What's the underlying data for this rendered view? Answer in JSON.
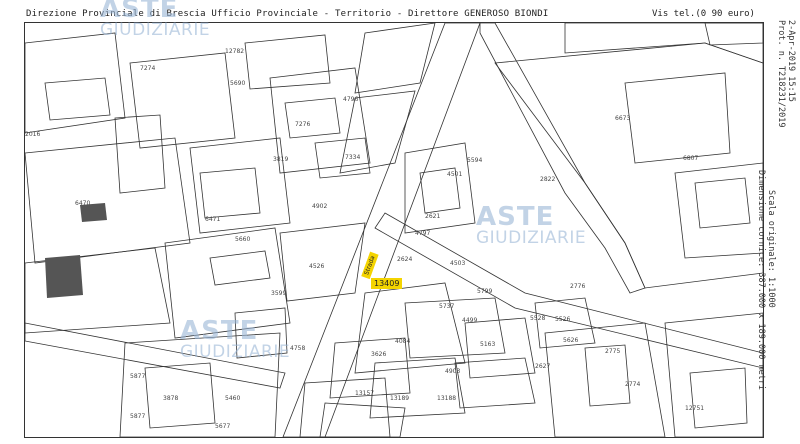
{
  "header": {
    "left_text": "Direzione Provinciale di Brescia  Ufficio Provinciale - Territorio - Direttore GENEROSO BIONDI",
    "right_text": "Vis  tel.(0 90 euro)"
  },
  "side_info": {
    "date": "2-Apr-2019 15:15",
    "prot": "Prot. n. T218231/2019",
    "scale": "Scala originale: 1:1000",
    "dims": "Dimensione cornice: 387.000 x 189.000 metri"
  },
  "watermarks": [
    {
      "brand": "ASTE",
      "sub": "GIUDIZIARIE"
    },
    {
      "brand": "ASTE",
      "sub": "GIUDIZIARIE"
    },
    {
      "brand": "ASTE",
      "sub": "GIUDIZIARIE"
    }
  ],
  "highlight_label": "13409",
  "street_label": "Strada",
  "parcels": [
    "7274",
    "12782",
    "5690",
    "4796",
    "7276",
    "4753",
    "2016",
    "7334",
    "3819",
    "5594",
    "4501",
    "2822",
    "6470",
    "6471",
    "2621",
    "4797",
    "4902",
    "5660",
    "4526",
    "2624",
    "4503",
    "5528",
    "3599",
    "5737",
    "4499",
    "5799",
    "3626",
    "5626",
    "4084",
    "5163",
    "4903",
    "13157",
    "13189",
    "13188",
    "2627",
    "12751",
    "5877",
    "5877",
    "2774",
    "5677",
    "5460",
    "3878",
    "6673",
    "6807",
    "2775",
    "5526",
    "2776",
    "4758",
    "5698",
    "5699",
    "5693",
    "13171"
  ]
}
